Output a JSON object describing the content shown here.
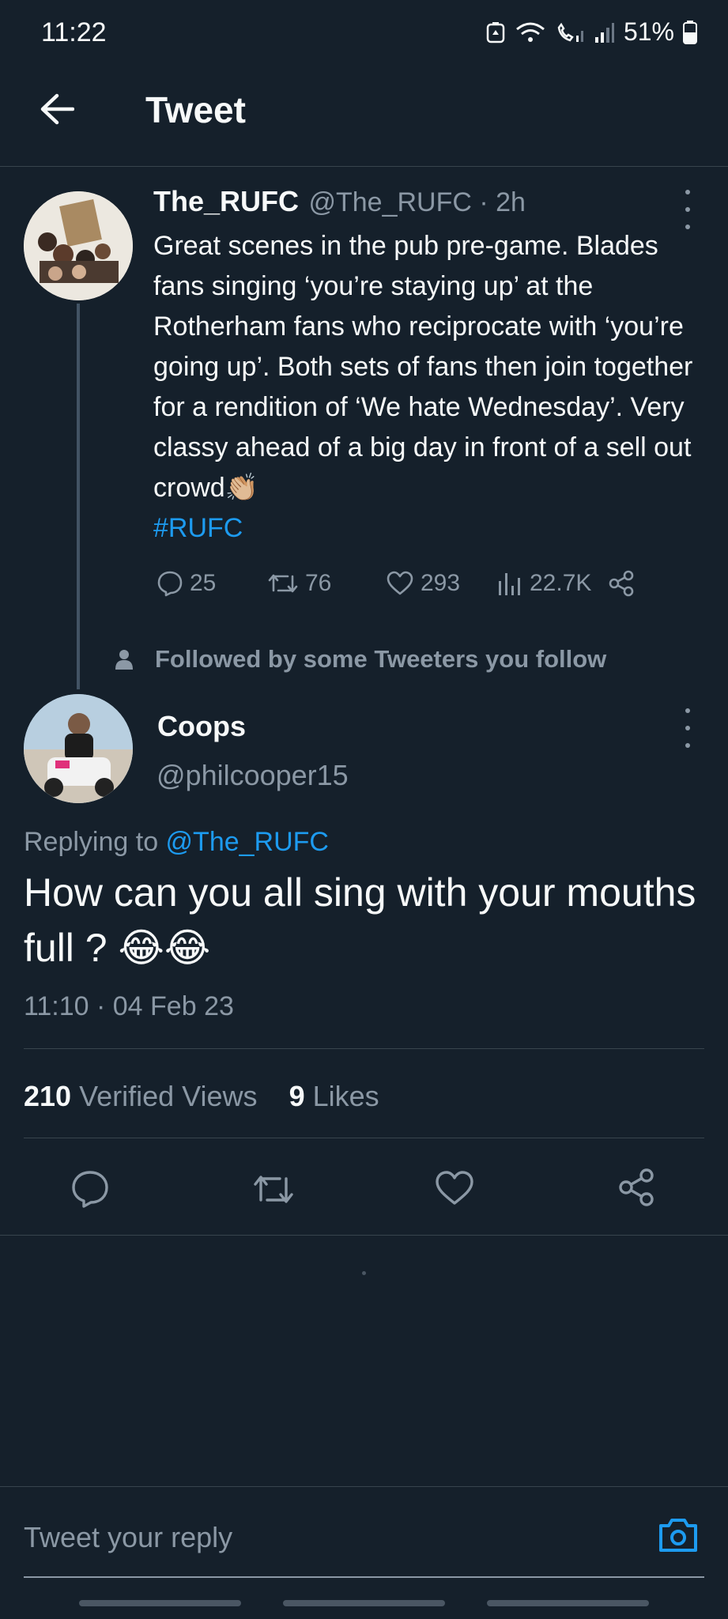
{
  "status_bar": {
    "time": "11:22",
    "battery": "51%"
  },
  "header": {
    "title": "Tweet"
  },
  "parent_tweet": {
    "name": "The_RUFC",
    "handle_time": "@The_RUFC · 2h",
    "text": "Great scenes in the pub pre-game. Blades fans singing ‘you’re staying up’ at the Rotherham fans who reciprocate with ‘you’re going up’. Both sets of fans then join together for a rendition of ‘We hate Wednesday’. Very classy ahead of a big day in front of a sell out crowd👏🏼",
    "hashtag": "#RUFC",
    "replies": "25",
    "retweets": "76",
    "likes": "293",
    "views": "22.7K"
  },
  "social_context": "Followed by some Tweeters you follow",
  "reply_tweet": {
    "name": "Coops",
    "handle": "@philcooper15",
    "replying_prefix": "Replying to ",
    "replying_to": "@The_RUFC",
    "text": "How can you all sing with your mouths full ? 😂😂",
    "timestamp": "11:10 · 04 Feb 23",
    "views_count": "210",
    "views_label": " Verified Views",
    "likes_count": "9",
    "likes_label": " Likes"
  },
  "composer": {
    "placeholder": "Tweet your reply"
  },
  "colors": {
    "background": "#15202b",
    "accent": "#1d9bf0",
    "muted": "#8b98a5"
  }
}
